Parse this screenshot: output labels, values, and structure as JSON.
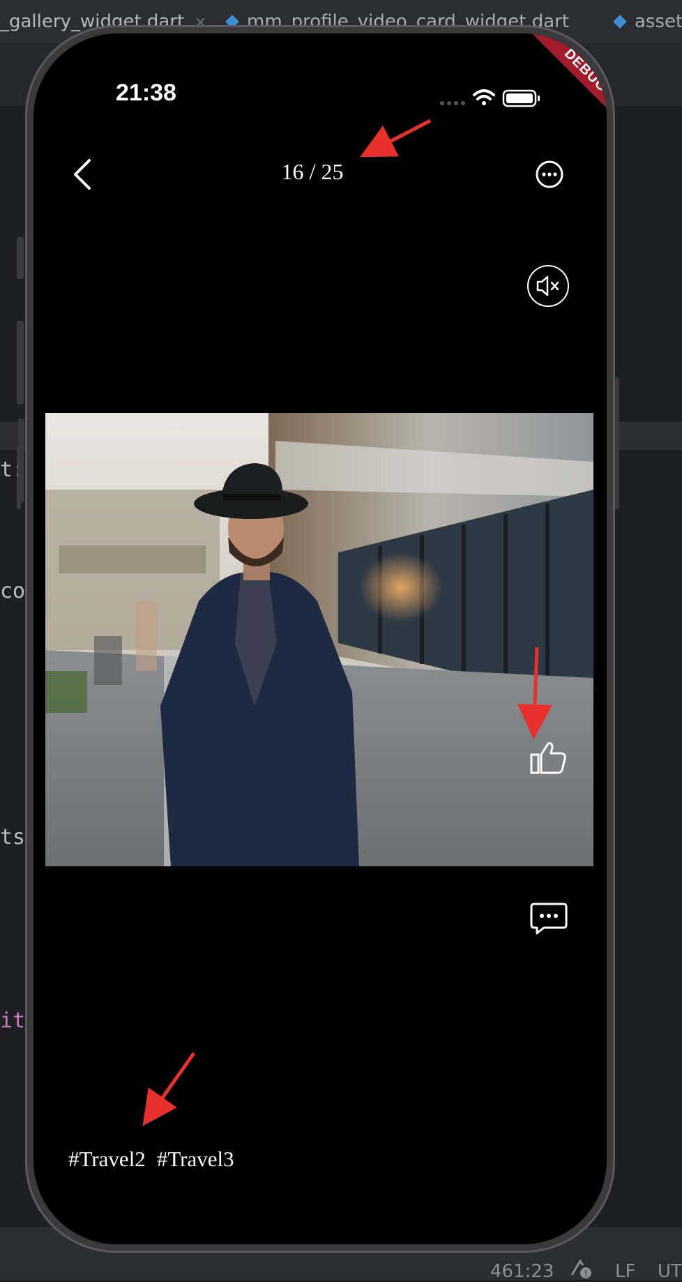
{
  "ide": {
    "tabs": [
      {
        "label": "_gallery_widget.dart",
        "close": "×"
      },
      {
        "label": "mm_profile_video_card_widget.dart"
      },
      {
        "label": "asset"
      }
    ],
    "code_fragments": [
      "t:",
      "co",
      "ts",
      "it"
    ],
    "status": {
      "position": "461:23",
      "line_ending": "LF",
      "encoding": "UT"
    }
  },
  "phone": {
    "status_bar": {
      "time": "21:38",
      "debug_label": "DEBUG"
    },
    "nav": {
      "back_icon": "chevron-left-icon",
      "counter": "16 / 25",
      "more_icon": "ellipsis-circle-icon"
    },
    "mute_icon": "speaker-mute-icon",
    "media_description": "video frame",
    "like_icon": "thumbs-up-icon",
    "comment_icon": "chat-bubble-icon",
    "hashtags": [
      "#Travel2",
      "#Travel3"
    ]
  },
  "colors": {
    "annotation": "#e8312c",
    "debug_ribbon": "#a31b2a"
  }
}
